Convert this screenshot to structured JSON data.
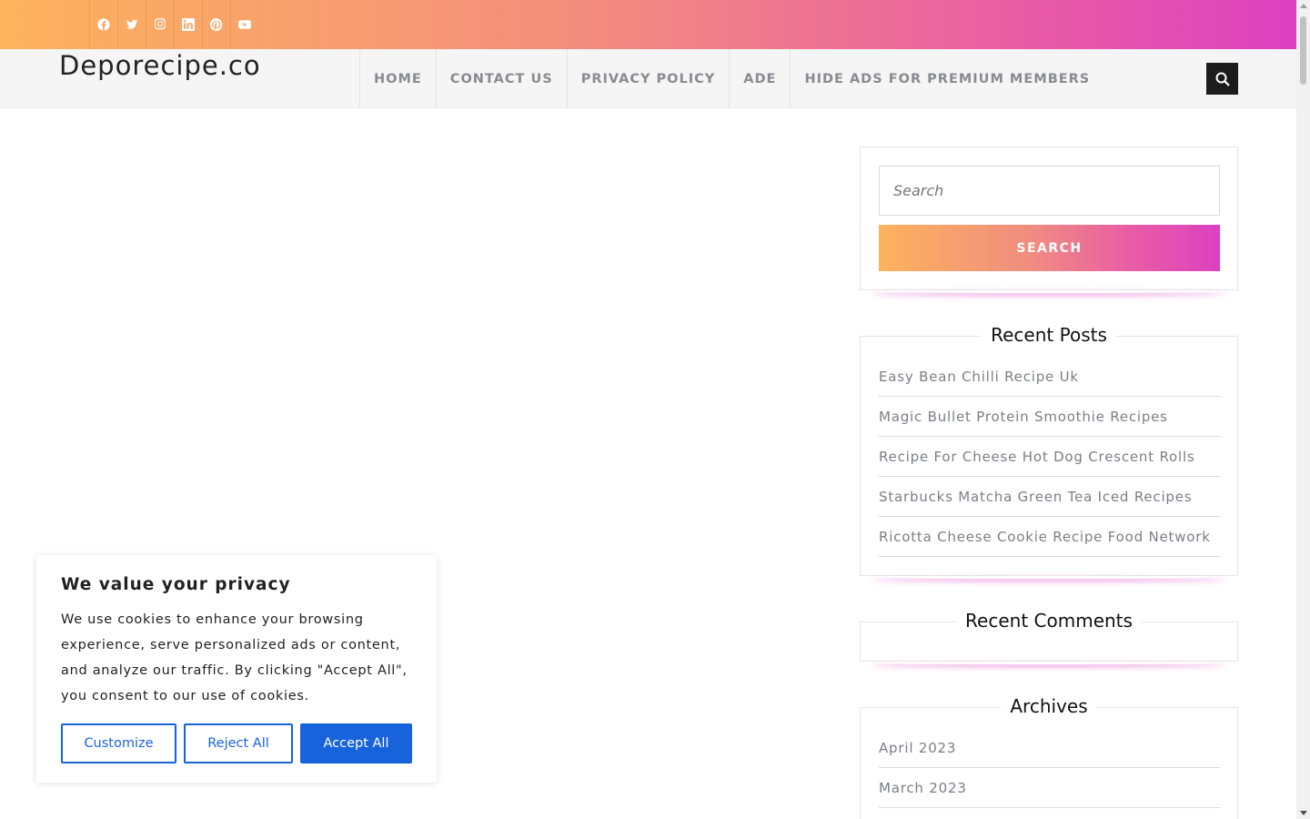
{
  "social": {
    "icons": [
      "facebook-icon",
      "twitter-icon",
      "instagram-icon",
      "linkedin-icon",
      "pinterest-icon",
      "youtube-icon"
    ]
  },
  "header": {
    "logo": "Deporecipe.co",
    "nav": [
      "HOME",
      "CONTACT US",
      "PRIVACY POLICY",
      "ADE",
      "HIDE ADS FOR PREMIUM MEMBERS"
    ]
  },
  "sidebar": {
    "search": {
      "placeholder": "Search",
      "button": "SEARCH"
    },
    "recent_posts": {
      "title": "Recent Posts",
      "items": [
        "Easy Bean Chilli Recipe Uk",
        "Magic Bullet Protein Smoothie Recipes",
        "Recipe For Cheese Hot Dog Crescent Rolls",
        "Starbucks Matcha Green Tea Iced Recipes",
        "Ricotta Cheese Cookie Recipe Food Network"
      ]
    },
    "recent_comments": {
      "title": "Recent Comments"
    },
    "archives": {
      "title": "Archives",
      "items": [
        "April 2023",
        "March 2023"
      ]
    }
  },
  "cookie": {
    "title": "We value your privacy",
    "text": "We use cookies to enhance your browsing experience, serve personalized ads or content, and analyze our traffic. By clicking \"Accept All\", you consent to our use of cookies.",
    "customize": "Customize",
    "reject": "Reject All",
    "accept": "Accept All"
  },
  "colors": {
    "gradient_start": "#fdb35c",
    "gradient_end": "#dc41c0",
    "accept_blue": "#1863dc"
  }
}
